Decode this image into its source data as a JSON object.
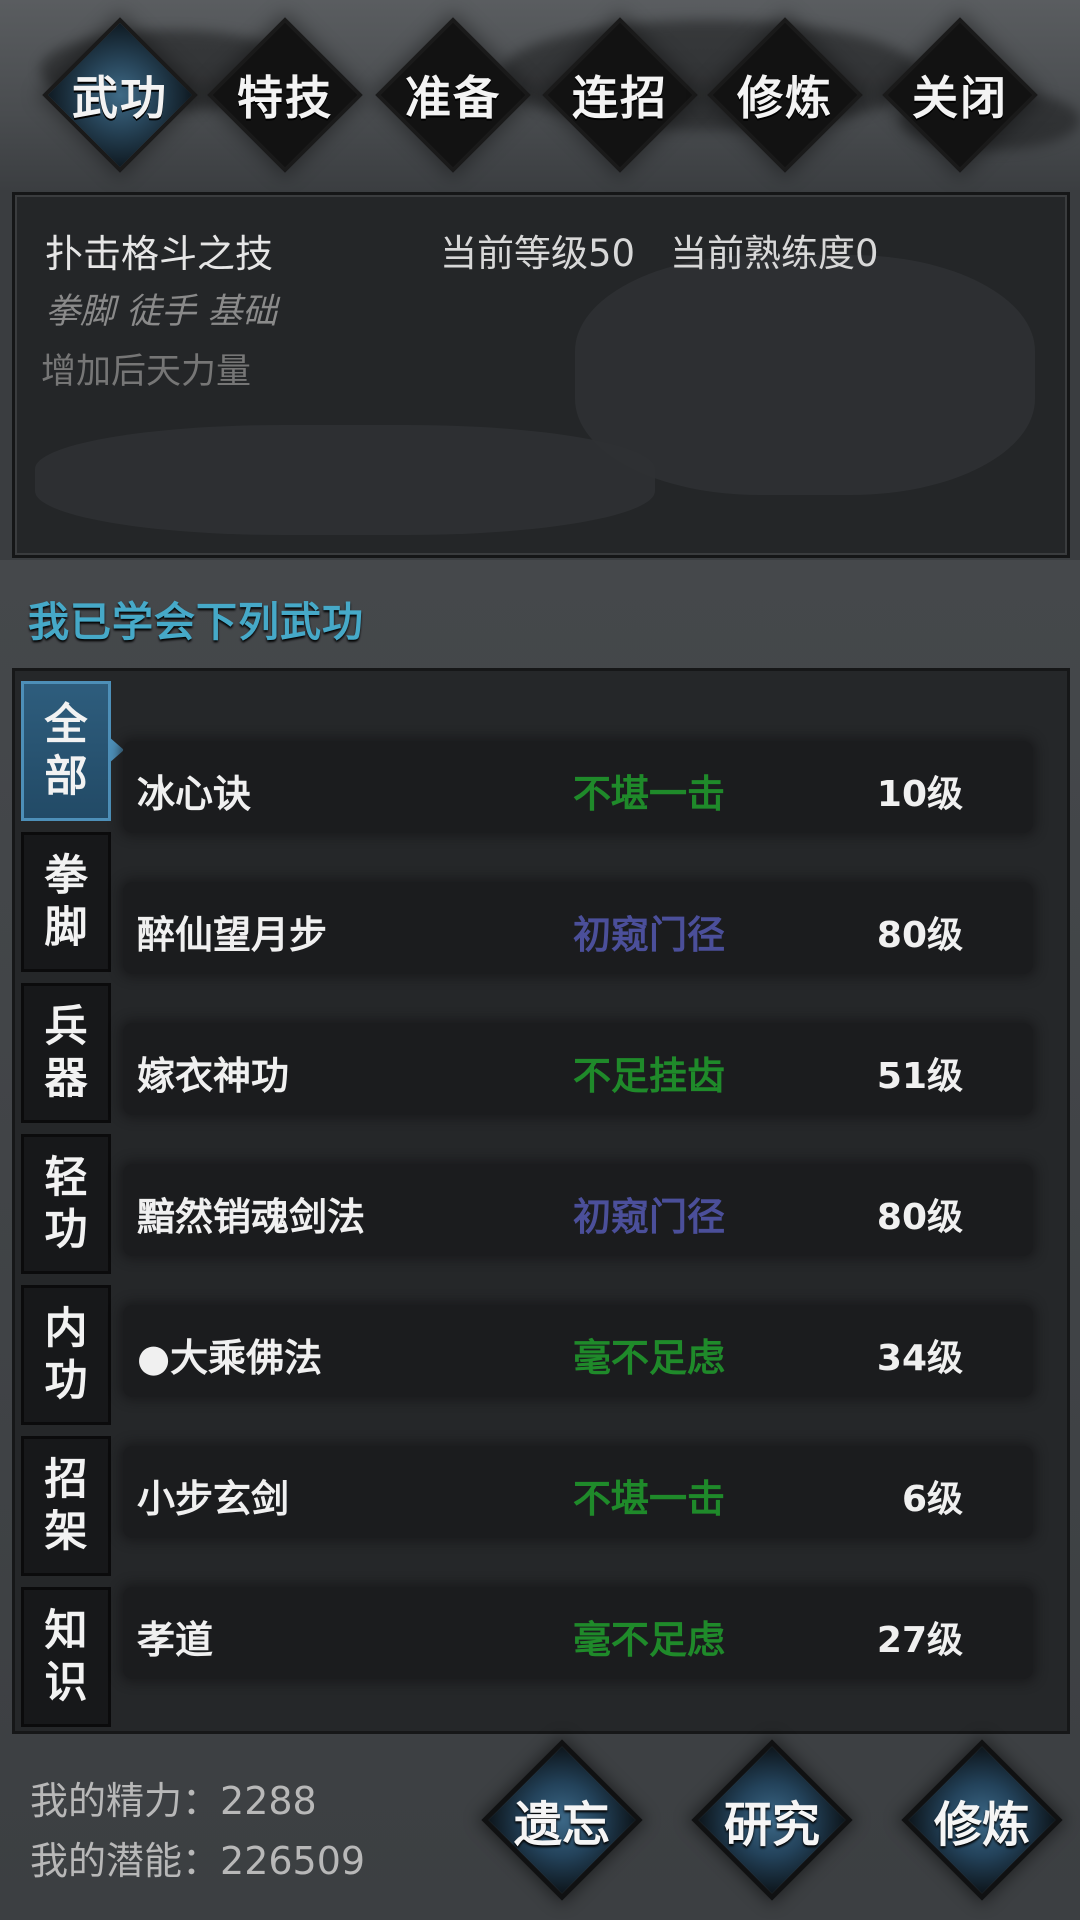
{
  "tabs": [
    {
      "label": "武功",
      "active": true
    },
    {
      "label": "特技",
      "active": false
    },
    {
      "label": "准备",
      "active": false
    },
    {
      "label": "连招",
      "active": false
    },
    {
      "label": "修炼",
      "active": false
    },
    {
      "label": "关闭",
      "active": false
    }
  ],
  "skill_info": {
    "name": "扑击格斗之技",
    "level_text": "当前等级50",
    "proficiency_text": "当前熟练度0",
    "tags": "拳脚 徒手 基础",
    "description": "增加后天力量"
  },
  "section_title": "我已学会下列武功",
  "categories": [
    {
      "c1": "全",
      "c2": "部",
      "active": true
    },
    {
      "c1": "拳",
      "c2": "脚",
      "active": false
    },
    {
      "c1": "兵",
      "c2": "器",
      "active": false
    },
    {
      "c1": "轻",
      "c2": "功",
      "active": false
    },
    {
      "c1": "内",
      "c2": "功",
      "active": false
    },
    {
      "c1": "招",
      "c2": "架",
      "active": false
    },
    {
      "c1": "知",
      "c2": "识",
      "active": false
    }
  ],
  "skills": [
    {
      "name": "冰心诀",
      "rank": "不堪一击",
      "rank_color": "#1f8a2a",
      "level": "10级"
    },
    {
      "name": "醉仙望月步",
      "rank": "初窥门径",
      "rank_color": "#4b4f9a",
      "level": "80级"
    },
    {
      "name": "嫁衣神功",
      "rank": "不足挂齿",
      "rank_color": "#1f8a2a",
      "level": "51级"
    },
    {
      "name": "黯然销魂剑法",
      "rank": "初窥门径",
      "rank_color": "#4b4f9a",
      "level": "80级"
    },
    {
      "name": "●大乘佛法",
      "rank": "毫不足虑",
      "rank_color": "#1f8a2a",
      "level": "34级"
    },
    {
      "name": "小步玄剑",
      "rank": "不堪一击",
      "rank_color": "#1f8a2a",
      "level": "6级"
    },
    {
      "name": "孝道",
      "rank": "毫不足虑",
      "rank_color": "#1f8a2a",
      "level": "27级"
    }
  ],
  "stats": {
    "energy_label": "我的精力：",
    "energy_value": "2288",
    "potential_label": "我的潜能：",
    "potential_value": "226509"
  },
  "actions": [
    "遗忘",
    "研究",
    "修炼"
  ],
  "colors": {
    "accent": "#46a9c8",
    "rank_green": "#1f8a2a",
    "rank_purple": "#4b4f9a"
  }
}
